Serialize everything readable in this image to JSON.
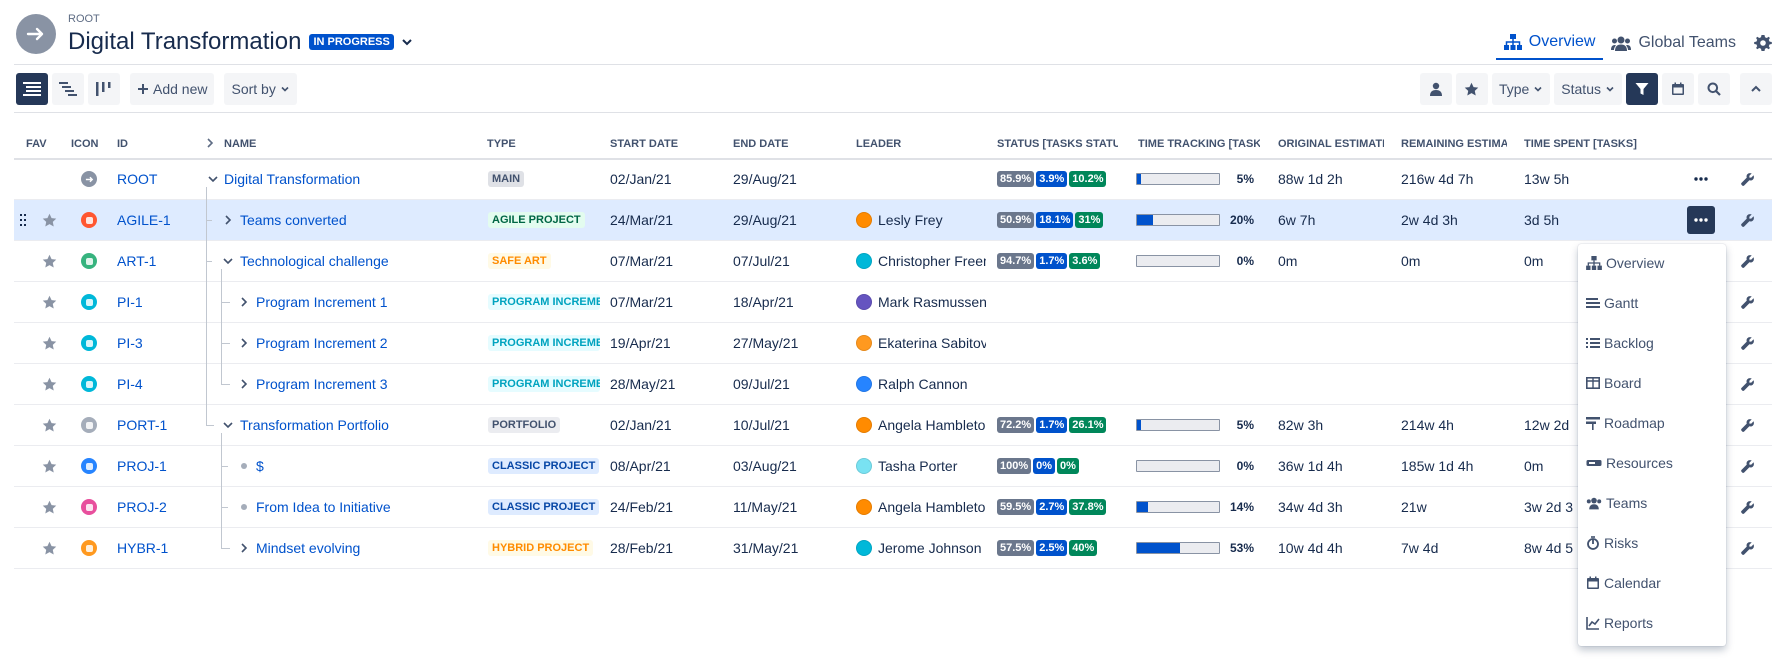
{
  "header": {
    "breadcrumb": "ROOT",
    "title": "Digital Transformation",
    "status": "IN PROGRESS",
    "tabs": [
      {
        "label": "Overview",
        "icon": "hierarchy-icon"
      },
      {
        "label": "Global Teams",
        "icon": "people-icon"
      }
    ]
  },
  "toolbar": {
    "add_new": "Add new",
    "sort_by": "Sort by",
    "type_filter": "Type",
    "status_filter": "Status"
  },
  "columns": {
    "fav": "FAV",
    "icon": "ICON",
    "id": "ID",
    "name": "NAME",
    "type": "TYPE",
    "start": "START DATE",
    "end": "END DATE",
    "leader": "LEADER",
    "status": "STATUS [TASKS STATUS]",
    "time_tracking": "TIME TRACKING [TASKS]",
    "original": "ORIGINAL ESTIMATE",
    "remaining": "REMAINING ESTIMATE",
    "spent": "TIME SPENT [TASKS]"
  },
  "rows": [
    {
      "id": "ROOT",
      "name": "Digital Transformation",
      "type": "MAIN",
      "start": "02/Jan/21",
      "end": "29/Aug/21",
      "leader": "",
      "status": [
        "85.9%",
        "3.9%",
        "10.2%"
      ],
      "tt_pct": "5%",
      "tt_fill": 0.05,
      "original": "88w 1d 2h",
      "remaining": "216w 4d 7h",
      "spent": "13w 5h",
      "icon_color": "#8993a4",
      "avatar_color": ""
    },
    {
      "id": "AGILE-1",
      "name": "Teams converted",
      "type": "AGILE PROJECT",
      "start": "24/Mar/21",
      "end": "29/Aug/21",
      "leader": "Lesly Frey",
      "status": [
        "50.9%",
        "18.1%",
        "31%"
      ],
      "tt_pct": "20%",
      "tt_fill": 0.2,
      "original": "6w 7h",
      "remaining": "2w 4d 3h",
      "spent": "3d 5h",
      "icon_color": "#ff5630",
      "avatar_color": "#ff8b00"
    },
    {
      "id": "ART-1",
      "name": "Technological challenge",
      "type": "SAFE ART",
      "start": "07/Mar/21",
      "end": "07/Jul/21",
      "leader": "Christopher Freeman",
      "status": [
        "94.7%",
        "1.7%",
        "3.6%"
      ],
      "tt_pct": "0%",
      "tt_fill": 0,
      "original": "0m",
      "remaining": "0m",
      "spent": "0m",
      "icon_color": "#36b37e",
      "avatar_color": "#00b8d9"
    },
    {
      "id": "PI-1",
      "name": "Program Increment 1",
      "type": "PROGRAM INCREMENT",
      "start": "07/Mar/21",
      "end": "18/Apr/21",
      "leader": "Mark Rasmussen",
      "status": [],
      "tt_pct": "",
      "tt_fill": null,
      "original": "",
      "remaining": "",
      "spent": "",
      "icon_color": "#00b8d9",
      "avatar_color": "#6554c0"
    },
    {
      "id": "PI-3",
      "name": "Program Increment 2",
      "type": "PROGRAM INCREMENT",
      "start": "19/Apr/21",
      "end": "27/May/21",
      "leader": "Ekaterina Sabitova",
      "status": [],
      "tt_pct": "",
      "tt_fill": null,
      "original": "",
      "remaining": "",
      "spent": "",
      "icon_color": "#00b8d9",
      "avatar_color": "#ff991f"
    },
    {
      "id": "PI-4",
      "name": "Program Increment 3",
      "type": "PROGRAM INCREMENT",
      "start": "28/May/21",
      "end": "09/Jul/21",
      "leader": "Ralph Cannon",
      "status": [],
      "tt_pct": "",
      "tt_fill": null,
      "original": "",
      "remaining": "",
      "spent": "",
      "icon_color": "#00b8d9",
      "avatar_color": "#2684ff"
    },
    {
      "id": "PORT-1",
      "name": "Transformation Portfolio",
      "type": "PORTFOLIO",
      "start": "02/Jan/21",
      "end": "10/Jul/21",
      "leader": "Angela Hambleton",
      "status": [
        "72.2%",
        "1.7%",
        "26.1%"
      ],
      "tt_pct": "5%",
      "tt_fill": 0.05,
      "original": "82w 3h",
      "remaining": "214w 4h",
      "spent": "12w 2d",
      "icon_color": "#a5adba",
      "avatar_color": "#ff8b00"
    },
    {
      "id": "PROJ-1",
      "name": "$",
      "type": "CLASSIC PROJECT",
      "start": "08/Apr/21",
      "end": "03/Aug/21",
      "leader": "Tasha Porter",
      "status": [
        "100%",
        "0%",
        "0%"
      ],
      "tt_pct": "0%",
      "tt_fill": 0,
      "original": "36w 1d 4h",
      "remaining": "185w 1d 4h",
      "spent": "0m",
      "icon_color": "#2684ff",
      "avatar_color": "#79e2f2"
    },
    {
      "id": "PROJ-2",
      "name": "From Idea to Initiative",
      "type": "CLASSIC PROJECT",
      "start": "24/Feb/21",
      "end": "11/May/21",
      "leader": "Angela Hambleton",
      "status": [
        "59.5%",
        "2.7%",
        "37.8%"
      ],
      "tt_pct": "14%",
      "tt_fill": 0.14,
      "original": "34w 4d 3h",
      "remaining": "21w",
      "spent": "3w 2d 3",
      "icon_color": "#e84f9d",
      "avatar_color": "#ff8b00"
    },
    {
      "id": "HYBR-1",
      "name": "Mindset evolving",
      "type": "HYBRID PROJECT",
      "start": "28/Feb/21",
      "end": "31/May/21",
      "leader": "Jerome Johnson",
      "status": [
        "57.5%",
        "2.5%",
        "40%"
      ],
      "tt_pct": "53%",
      "tt_fill": 0.53,
      "original": "10w 4d 4h",
      "remaining": "7w 4d",
      "spent": "8w 4d 5",
      "icon_color": "#ff991f",
      "avatar_color": "#00b8d9"
    }
  ],
  "menu": {
    "items": [
      {
        "label": "Overview",
        "icon": "hierarchy-icon"
      },
      {
        "label": "Gantt",
        "icon": "gantt-icon"
      },
      {
        "label": "Backlog",
        "icon": "list-icon"
      },
      {
        "label": "Board",
        "icon": "board-icon"
      },
      {
        "label": "Roadmap",
        "icon": "roadmap-icon"
      },
      {
        "label": "Resources",
        "icon": "resources-icon"
      },
      {
        "label": "Teams",
        "icon": "people-icon"
      },
      {
        "label": "Risks",
        "icon": "risk-icon"
      },
      {
        "label": "Calendar",
        "icon": "calendar-icon"
      },
      {
        "label": "Reports",
        "icon": "reports-icon"
      }
    ]
  },
  "type_colors": {
    "MAIN": [
      "#dfe1e6",
      "#42526e"
    ],
    "AGILE PROJECT": [
      "#e3fcef",
      "#006644"
    ],
    "SAFE ART": [
      "#fffae6",
      "#ff8b00"
    ],
    "PROGRAM INCREMENT": [
      "#e6fcff",
      "#00a3bf"
    ],
    "PORTFOLIO": [
      "#ebecf0",
      "#42526e"
    ],
    "CLASSIC PROJECT": [
      "#deebff",
      "#0747a6"
    ],
    "HYBRID PROJECT": [
      "#fffae6",
      "#ff8b00"
    ]
  }
}
